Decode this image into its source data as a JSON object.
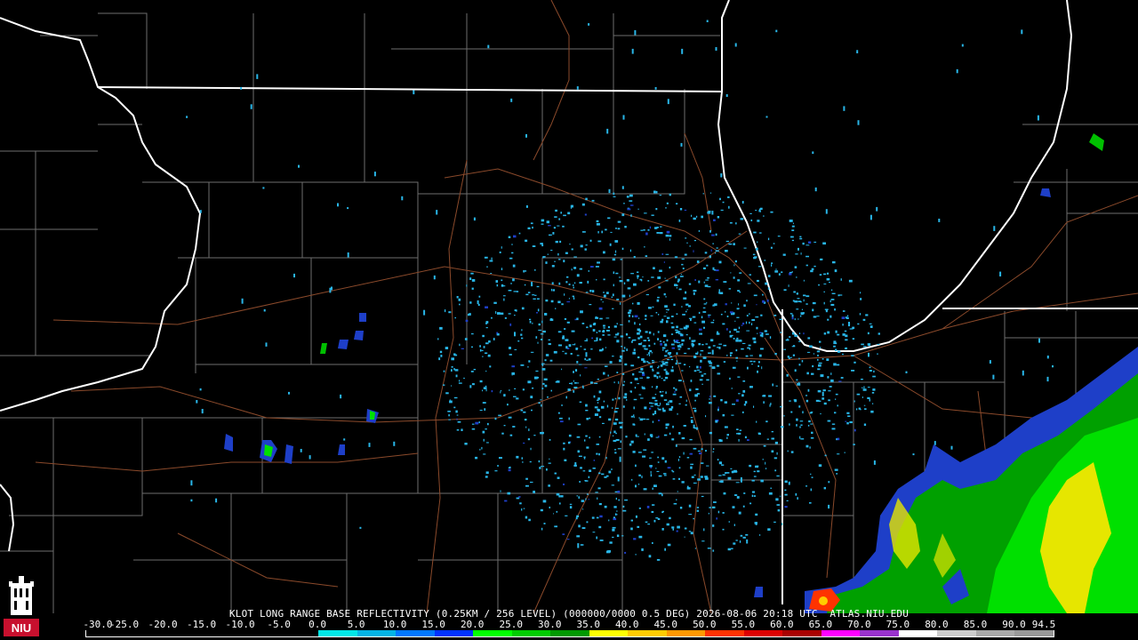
{
  "title": "KLOT LONG RANGE BASE REFLECTIVITY (0.25KM / 256 LEVEL) (000000/0000 0.5 DEG) 2026-08-06 20:18 UTC  ATLAS.NIU.EDU",
  "scale": {
    "labels": [
      "-30.0",
      "-25.0",
      "-20.0",
      "-15.0",
      "-10.0",
      "-5.0",
      "0.0",
      "5.0",
      "10.0",
      "15.0",
      "20.0",
      "25.0",
      "30.0",
      "35.0",
      "40.0",
      "45.0",
      "50.0",
      "55.0",
      "60.0",
      "65.0",
      "70.0",
      "75.0",
      "80.0",
      "85.0",
      "90.0",
      "94.5"
    ],
    "colors": [
      "#000000",
      "#000000",
      "#000000",
      "#000000",
      "#000000",
      "#000000",
      "#00e6e6",
      "#04b4e4",
      "#0078ff",
      "#0033ff",
      "#00ff00",
      "#00cc00",
      "#009900",
      "#ffff00",
      "#ffcc00",
      "#ff9900",
      "#ff3300",
      "#dd0000",
      "#aa0000",
      "#ff00ff",
      "#9933cc",
      "#ffffff",
      "#cccccc",
      "#aaaaaa",
      "#999999"
    ]
  },
  "logo": {
    "text": "NIU",
    "color": "#c8102e"
  },
  "map_colors": {
    "state_border": "#ffffff",
    "county_line": "#808080",
    "highway": "#8b4a2b",
    "clutter": "#29b6e8"
  }
}
